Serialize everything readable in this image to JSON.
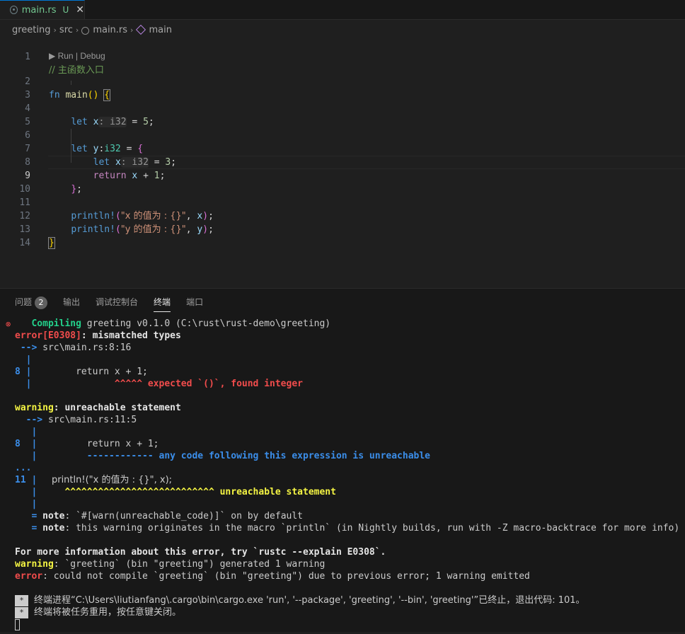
{
  "tab": {
    "filename": "main.rs",
    "status": "U",
    "close": "✕",
    "icon": "rust-file-icon",
    "accent": "#0078d4"
  },
  "breadcrumb": {
    "items": [
      "greeting",
      "src",
      "main.rs",
      "main"
    ],
    "sep": "›"
  },
  "editor": {
    "codelens": "▶ Run | Debug",
    "line_numbers": [
      "1",
      "2",
      "3",
      "4",
      "5",
      "6",
      "7",
      "8",
      "9",
      "10",
      "11",
      "12",
      "13",
      "14"
    ],
    "active_line": "9",
    "l1": "// 主函数入口",
    "l2": {
      "kw": "fn",
      "name": "main",
      "parens": "()",
      "brace": "{"
    },
    "l4": {
      "kw": "let",
      "var": "x",
      "hint": ": i32",
      "rest": " = ",
      "num": "5",
      "end": ";"
    },
    "l6": {
      "kw": "let",
      "var": "y",
      "colon": ":",
      "type": "i32",
      "rest": " = ",
      "brace": "{"
    },
    "l7": {
      "kw": "let",
      "var": "x",
      "hint": ": i32",
      "rest": " = ",
      "num": "3",
      "end": ";"
    },
    "l8": {
      "kw": "return",
      "var": "x",
      "rest": " + ",
      "num": "1",
      "end": ";"
    },
    "l9": {
      "brace": "}",
      "end": ";"
    },
    "l11": {
      "macro": "println!",
      "open": "(",
      "str": "\"x 的值为 : {}\"",
      "comma": ", ",
      "var": "x",
      "close": ")",
      "end": ";"
    },
    "l12": {
      "macro": "println!",
      "open": "(",
      "str": "\"y 的值为 : {}\"",
      "comma": ", ",
      "var": "y",
      "close": ")",
      "end": ";"
    },
    "l13": {
      "brace": "}"
    }
  },
  "panel": {
    "tabs": [
      "问题",
      "输出",
      "调试控制台",
      "终端",
      "端口"
    ],
    "problems_count": "2",
    "active_tab": "终端"
  },
  "terminal": {
    "t1": {
      "a": "   Compiling",
      "b": " greeting v0.1.0 (C:\\rust\\rust-demo\\greeting)"
    },
    "t2": {
      "a": "error[E0308]",
      "b": ": mismatched types"
    },
    "t3": {
      "a": " --> ",
      "b": "src\\main.rs:8:16"
    },
    "t4": "  |",
    "t5": {
      "a": "8 |",
      "b": "        return x + 1;"
    },
    "t6": {
      "a": "  |",
      "b": "               ^^^^^ expected `()`, found integer"
    },
    "t8": {
      "a": "warning",
      "b": ": unreachable statement"
    },
    "t9": {
      "a": "  --> ",
      "b": "src\\main.rs:11:5"
    },
    "t10": "   |",
    "t11": {
      "a": "8  |",
      "b": "         return x + 1;"
    },
    "t12": {
      "a": "   |",
      "b": "         ------------ any code following this expression is unreachable"
    },
    "t13": "...",
    "t14": {
      "a": "11 |",
      "b": "     println!(\"x 的值为 : {}\", x);"
    },
    "t15": {
      "a": "   |",
      "b": "     ^^^^^^^^^^^^^^^^^^^^^^^^^^^ unreachable statement"
    },
    "t16": "   |",
    "t17": {
      "a": "   = ",
      "b": "note",
      "c": ": `#[warn(unreachable_code)]` on by default"
    },
    "t18": {
      "a": "   = ",
      "b": "note",
      "c": ": this warning originates in the macro `println` (in Nightly builds, run with -Z macro-backtrace for more info)"
    },
    "t20": "For more information about this error, try `rustc --explain E0308`.",
    "t21": {
      "a": "warning",
      "b": ": `greeting` (bin \"greeting\") generated 1 warning"
    },
    "t22": {
      "a": "error",
      "b": ": could not compile `greeting` (bin \"greeting\") due to previous error; 1 warning emitted"
    },
    "t24": "终端进程“C:\\Users\\liutianfang\\.cargo\\bin\\cargo.exe 'run', '--package', 'greeting', '--bin', 'greeting'”已终止，退出代码: 101。",
    "t25": "终端将被任务重用，按任意键关闭。",
    "star": "*",
    "err_marker": "⊗"
  }
}
